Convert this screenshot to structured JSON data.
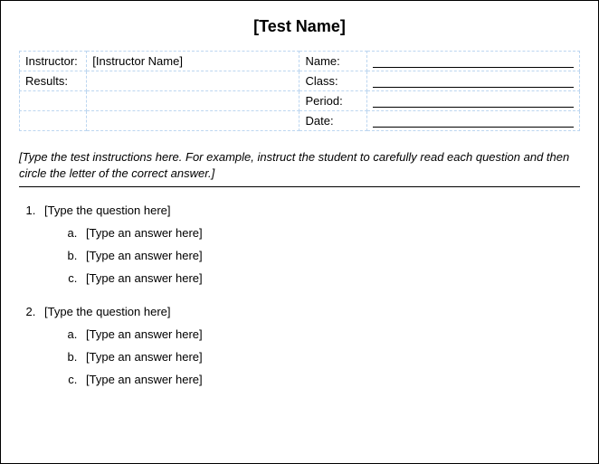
{
  "title": "[Test Name]",
  "info": {
    "instructor_label": "Instructor:",
    "instructor_value": "[Instructor Name]",
    "results_label": "Results:",
    "results_value": "",
    "name_label": "Name:",
    "class_label": "Class:",
    "period_label": "Period:",
    "date_label": "Date:"
  },
  "instructions": "[Type the test instructions here.  For example, instruct the student to carefully read each question and then circle the letter of the correct answer.]",
  "questions": [
    {
      "text": "[Type the question here]",
      "answers": [
        "[Type an answer here]",
        "[Type an answer here]",
        "[Type an answer here]"
      ]
    },
    {
      "text": "[Type the question here]",
      "answers": [
        "[Type an answer here]",
        "[Type an answer here]",
        "[Type an answer here]"
      ]
    }
  ]
}
